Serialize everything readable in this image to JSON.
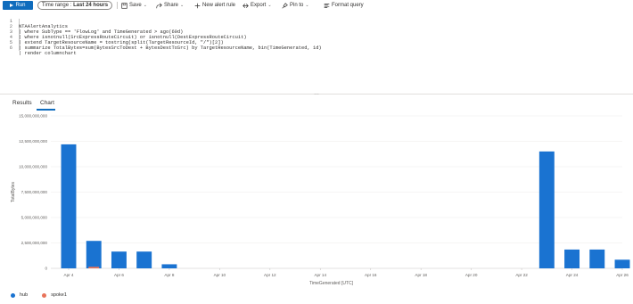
{
  "toolbar": {
    "run_label": "Run",
    "time_range_prefix": "Time range :",
    "time_range_value": "Last 24 hours",
    "save_label": "Save",
    "share_label": "Share",
    "new_alert_label": "New alert rule",
    "export_label": "Export",
    "pin_label": "Pin to",
    "format_label": "Format query"
  },
  "editor": {
    "lines": [
      {
        "num": "1",
        "text": "NTAAlertAnalytics"
      },
      {
        "num": "2",
        "text": "| where SubType == 'FlowLog' and TimeGenerated > ago(60d)"
      },
      {
        "num": "3",
        "text": "| where isnotnull(SrcExpressRouteCircuit) or isnotnull(DestExpressRouteCircuit)"
      },
      {
        "num": "4",
        "text": "| extend TargetResourceName = tostring(split(TargetResourceId, \"/\")[2])"
      },
      {
        "num": "5",
        "text": "| summarize TotalBytes=sum(BytesSrcToDest + BytesDestToSrc) by TargetResourceName, bin(TimeGenerated, 1d)"
      },
      {
        "num": "6",
        "text": "| render columnchart"
      }
    ]
  },
  "tabs": {
    "results": "Results",
    "chart": "Chart"
  },
  "colors": {
    "accent": "#0f6cbd",
    "hub": "#1a73d1",
    "spoke1": "#e8735a"
  },
  "chart_data": {
    "type": "bar",
    "xlabel": "TimeGenerated [UTC]",
    "ylabel": "TotalBytes",
    "ylim": [
      0,
      15000000000
    ],
    "yticks": [
      "0",
      "2,500,000,000",
      "5,000,000,000",
      "7,500,000,000",
      "10,000,000,000",
      "12,500,000,000",
      "15,000,000,000"
    ],
    "x_tick_labels": [
      "Apr 4",
      "Apr 6",
      "Apr 8",
      "Apr 10",
      "Apr 12",
      "Apr 14",
      "Apr 16",
      "Apr 18",
      "Apr 20",
      "Apr 22",
      "Apr 24",
      "Apr 26"
    ],
    "grid": true,
    "legend_placement": "bottom-left",
    "series": [
      {
        "name": "hub",
        "points": [
          {
            "date": "Apr 4",
            "value": 12200000000
          },
          {
            "date": "Apr 5",
            "value": 2700000000
          },
          {
            "date": "Apr 6",
            "value": 1650000000
          },
          {
            "date": "Apr 7",
            "value": 1650000000
          },
          {
            "date": "Apr 8",
            "value": 400000000
          },
          {
            "date": "Apr 23",
            "value": 11500000000
          },
          {
            "date": "Apr 24",
            "value": 1850000000
          },
          {
            "date": "Apr 25",
            "value": 1850000000
          },
          {
            "date": "Apr 26",
            "value": 850000000
          }
        ]
      },
      {
        "name": "spoke1",
        "points": [
          {
            "date": "Apr 5",
            "value": 150000000
          }
        ]
      }
    ]
  }
}
